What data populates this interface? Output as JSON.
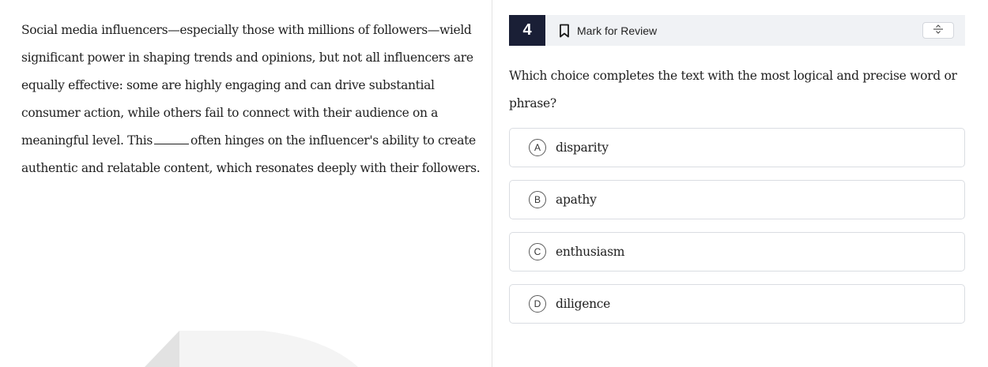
{
  "passage": {
    "lines": [
      "Social media influencers—especially those with millions of followers—wield",
      "significant power in shaping trends and opinions, but not all influencers are",
      "equally effective: some are highly engaging and can drive substantial",
      "consumer action, while others fail to connect with their audience on a"
    ],
    "line5_before": "meaningful level. This",
    "line5_after": "often hinges on the influencer's ability to create",
    "line6": "authentic and relatable content, which resonates deeply with their followers."
  },
  "question": {
    "number": "4",
    "mark_review_label": "Mark for Review",
    "prompt_line1": "Which choice completes the text with the most logical and precise word or",
    "prompt_line2": "phrase?"
  },
  "choices": [
    {
      "letter": "A",
      "text": "disparity"
    },
    {
      "letter": "B",
      "text": "apathy"
    },
    {
      "letter": "C",
      "text": "enthusiasm"
    },
    {
      "letter": "D",
      "text": "diligence"
    }
  ],
  "icons": {
    "bookmark": "bookmark-icon",
    "strikethrough": "strikethrough-icon"
  },
  "colors": {
    "number_badge_bg": "#1a1f36",
    "header_bg": "#f0f2f5",
    "choice_border": "#dadde2"
  }
}
